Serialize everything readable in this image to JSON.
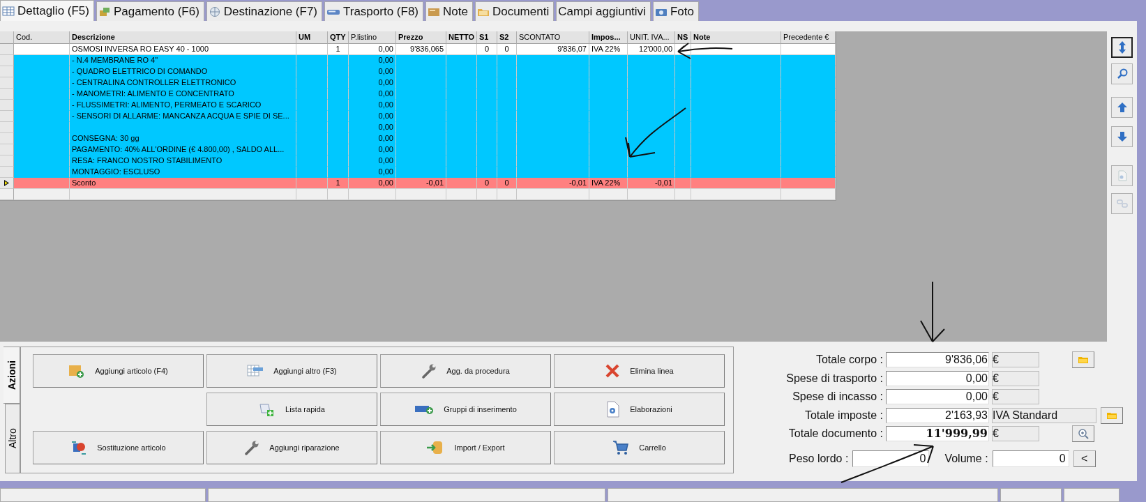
{
  "tabs": [
    {
      "label": "Dettaglio (F5)",
      "selected": true
    },
    {
      "label": "Pagamento (F6)",
      "selected": false
    },
    {
      "label": "Destinazione (F7)",
      "selected": false
    },
    {
      "label": "Trasporto (F8)",
      "selected": false
    },
    {
      "label": "Note",
      "selected": false
    },
    {
      "label": "Documenti",
      "selected": false
    },
    {
      "label": "Campi aggiuntivi",
      "selected": false
    },
    {
      "label": "Foto",
      "selected": false
    }
  ],
  "table": {
    "columns": [
      {
        "label": "Cod.",
        "bold": false
      },
      {
        "label": "Descrizione",
        "bold": true
      },
      {
        "label": "UM",
        "bold": true
      },
      {
        "label": "QTY",
        "bold": true
      },
      {
        "label": "P.listino",
        "bold": false
      },
      {
        "label": "Prezzo",
        "bold": true
      },
      {
        "label": "NETTO",
        "bold": true
      },
      {
        "label": "S1",
        "bold": true
      },
      {
        "label": "S2",
        "bold": true
      },
      {
        "label": "SCONTATO",
        "bold": false
      },
      {
        "label": "Impos...",
        "bold": true
      },
      {
        "label": "UNIT. IVA...",
        "bold": false
      },
      {
        "label": "NS",
        "bold": true
      },
      {
        "label": "Note",
        "bold": true
      },
      {
        "label": "Precedente €",
        "bold": false
      }
    ],
    "rows": [
      {
        "kind": "article",
        "current": false,
        "descrizione": "OSMOSI INVERSA RO EASY 40 - 1000",
        "qty": "1",
        "p_listino": "0,00",
        "prezzo": "9'836,065",
        "s1": "0",
        "s2": "0",
        "scontato": "9'836,07",
        "imposta": "IVA 22%",
        "unit_iva": "12'000,00"
      },
      {
        "kind": "text",
        "current": false,
        "descrizione": "- N.4 MEMBRANE RO 4\"",
        "p_listino": "0,00"
      },
      {
        "kind": "text",
        "current": false,
        "descrizione": "- QUADRO ELETTRICO DI COMANDO",
        "p_listino": "0,00"
      },
      {
        "kind": "text",
        "current": false,
        "descrizione": "- CENTRALINA CONTROLLER ELETTRONICO",
        "p_listino": "0,00"
      },
      {
        "kind": "text",
        "current": false,
        "descrizione": "- MANOMETRI: ALIMENTO E CONCENTRATO",
        "p_listino": "0,00"
      },
      {
        "kind": "text",
        "current": false,
        "descrizione": "- FLUSSIMETRI: ALIMENTO, PERMEATO E SCARICO",
        "p_listino": "0,00"
      },
      {
        "kind": "text",
        "current": false,
        "descrizione": "- SENSORI DI ALLARME: MANCANZA ACQUA E SPIE DI SE...",
        "p_listino": "0,00"
      },
      {
        "kind": "text",
        "current": false,
        "p_listino": "0,00"
      },
      {
        "kind": "text",
        "current": false,
        "descrizione": "CONSEGNA: 30 gg",
        "p_listino": "0,00"
      },
      {
        "kind": "text",
        "current": false,
        "descrizione": "PAGAMENTO: 40% ALL'ORDINE (€ 4.800,00) , SALDO ALL...",
        "p_listino": "0,00"
      },
      {
        "kind": "text",
        "current": false,
        "descrizione": "RESA: FRANCO NOSTRO STABILIMENTO",
        "p_listino": "0,00"
      },
      {
        "kind": "text",
        "current": false,
        "descrizione": "MONTAGGIO: ESCLUSO",
        "p_listino": "0,00"
      },
      {
        "kind": "discount",
        "current": true,
        "descrizione": "Sconto",
        "qty": "1",
        "p_listino": "0,00",
        "prezzo": "-0,01",
        "s1": "0",
        "s2": "0",
        "scontato": "-0,01",
        "imposta": "IVA 22%",
        "unit_iva": "-0,01"
      },
      {
        "kind": "empty",
        "current": false
      }
    ]
  },
  "tool_buttons": [
    {
      "focused": true,
      "disabled": false
    },
    {
      "focused": false,
      "disabled": false
    },
    {
      "focused": false,
      "disabled": false
    },
    {
      "focused": false,
      "disabled": false
    },
    {
      "focused": false,
      "disabled": true
    },
    {
      "focused": false,
      "disabled": true
    }
  ],
  "action_tabs": [
    {
      "label": "Azioni",
      "selected": true
    },
    {
      "label": "Altro",
      "selected": false
    }
  ],
  "action_rows": [
    [
      "Aggiungi articolo (F4)",
      "Aggiungi altro (F3)",
      "Agg. da procedura",
      "Elimina linea"
    ],
    [
      "Lista rapida",
      "Gruppi di inserimento",
      "Elaborazioni"
    ],
    [
      "Sostituzione articolo",
      "Aggiungi riparazione",
      "Import / Export",
      "Carrello"
    ]
  ],
  "totals": [
    {
      "label": "Totale corpo :",
      "value": "9'836,06",
      "unit": "€",
      "kind": "folder",
      "highlight": false
    },
    {
      "label": "Spese di trasporto :",
      "value": "0,00",
      "unit": "€",
      "kind": "plain",
      "highlight": false
    },
    {
      "label": "Spese di incasso :",
      "value": "0,00",
      "unit": "€",
      "kind": "plain",
      "highlight": false
    },
    {
      "label": "Totale imposte :",
      "value": "2'163,93",
      "unit": "IVA Standard",
      "kind": "folder",
      "highlight": false
    },
    {
      "label": "Totale documento :",
      "value": "11'999,99",
      "unit": "€",
      "kind": "zoom",
      "highlight": true
    }
  ],
  "measures": [
    {
      "label": "Peso lordo :",
      "value": "0"
    },
    {
      "label": "Volume :",
      "value": "0"
    }
  ],
  "measure_button": "<"
}
